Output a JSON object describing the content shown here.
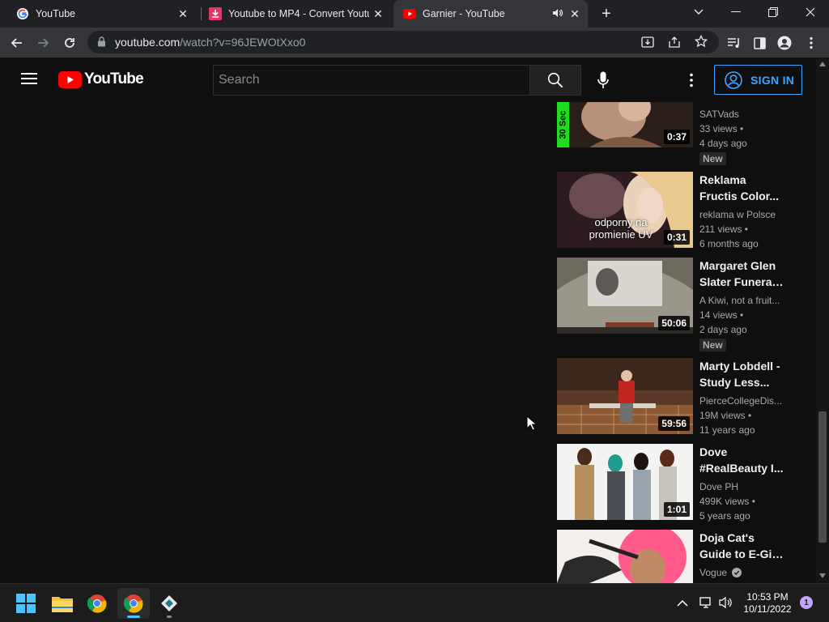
{
  "browser": {
    "tabs": [
      {
        "title": "YouTube",
        "icon": "google-icon"
      },
      {
        "title": "Youtube to MP4 - Convert Youtu",
        "icon": "download-icon"
      },
      {
        "title": "Garnier - YouTube",
        "icon": "youtube-icon",
        "active": true,
        "audio": true
      }
    ],
    "address": {
      "host": "youtube.com",
      "path": "/watch?v=96JEWOtXxo0"
    }
  },
  "youtube": {
    "logo_text": "YouTube",
    "search_placeholder": "Search",
    "sign_in_label": "SIGN IN",
    "brand_red": "#ff0000",
    "accent_blue": "#3ea6ff"
  },
  "recommendations": [
    {
      "title_lines": [],
      "channel": "SATVads",
      "views": "33 views •",
      "age": "4 days ago",
      "badge": "New",
      "duration": "0:37",
      "thumb_text": "30 Sec"
    },
    {
      "title_lines": [
        "Reklama",
        "Fructis Color..."
      ],
      "channel": "reklama w Polsce",
      "views": "211 views •",
      "age": "6 months ago",
      "badge": "",
      "duration": "0:31",
      "thumb_text": "odporny na promienie UV"
    },
    {
      "title_lines": [
        "Margaret Glen",
        "Slater Funeral..."
      ],
      "channel": "A Kiwi, not a fruit...",
      "views": "14 views •",
      "age": "2 days ago",
      "badge": "New",
      "duration": "50:06",
      "thumb_text": ""
    },
    {
      "title_lines": [
        "Marty Lobdell -",
        "Study Less..."
      ],
      "channel": "PierceCollegeDis...",
      "views": "19M views •",
      "age": "11 years ago",
      "badge": "",
      "duration": "59:56",
      "thumb_text": ""
    },
    {
      "title_lines": [
        "Dove",
        "#RealBeauty I..."
      ],
      "channel": "Dove PH",
      "views": "499K views •",
      "age": "5 years ago",
      "badge": "",
      "duration": "1:01",
      "thumb_text": ""
    },
    {
      "title_lines": [
        "Doja Cat's",
        "Guide to E-Girl..."
      ],
      "channel": "Vogue",
      "views": "",
      "age": "",
      "badge": "",
      "duration": "",
      "thumb_text": "",
      "verified": true
    }
  ],
  "taskbar": {
    "apps": [
      "windows-start-icon",
      "file-explorer-icon",
      "chrome-icon",
      "chrome-active-icon",
      "app-icon"
    ],
    "time": "10:53 PM",
    "date": "10/11/2022",
    "notifications": "1"
  }
}
